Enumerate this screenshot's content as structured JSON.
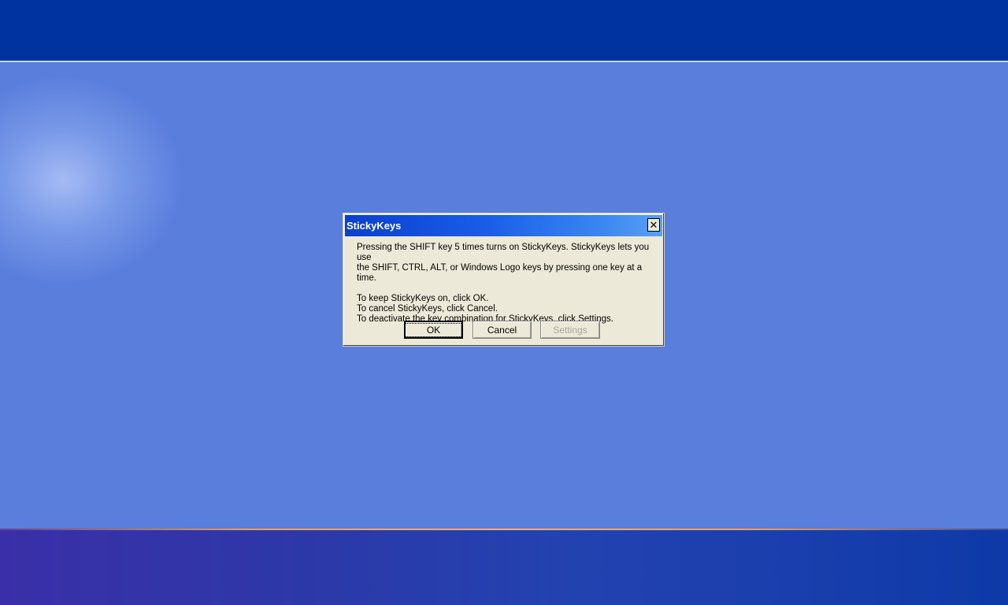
{
  "dialog": {
    "title": "StickyKeys",
    "close_glyph": "✕",
    "close_icon": "close-icon",
    "line1": "Pressing the SHIFT key 5 times turns on StickyKeys. StickyKeys lets you use",
    "line2": "the SHIFT, CTRL, ALT, or Windows Logo keys by pressing one key at a time.",
    "line3": "To keep StickyKeys on, click OK.",
    "line4": "To cancel StickyKeys, click Cancel.",
    "line5": "To deactivate the key combination for StickyKeys, click Settings.",
    "ok_label": "OK",
    "cancel_label": "Cancel",
    "settings_label": "Settings"
  },
  "colors": {
    "desktop": "#5a7edc",
    "top_band": "#0033a0",
    "titlebar": "#1a5ee8",
    "dialog_face": "#ece9d8",
    "disabled_text": "#a7a69c"
  }
}
